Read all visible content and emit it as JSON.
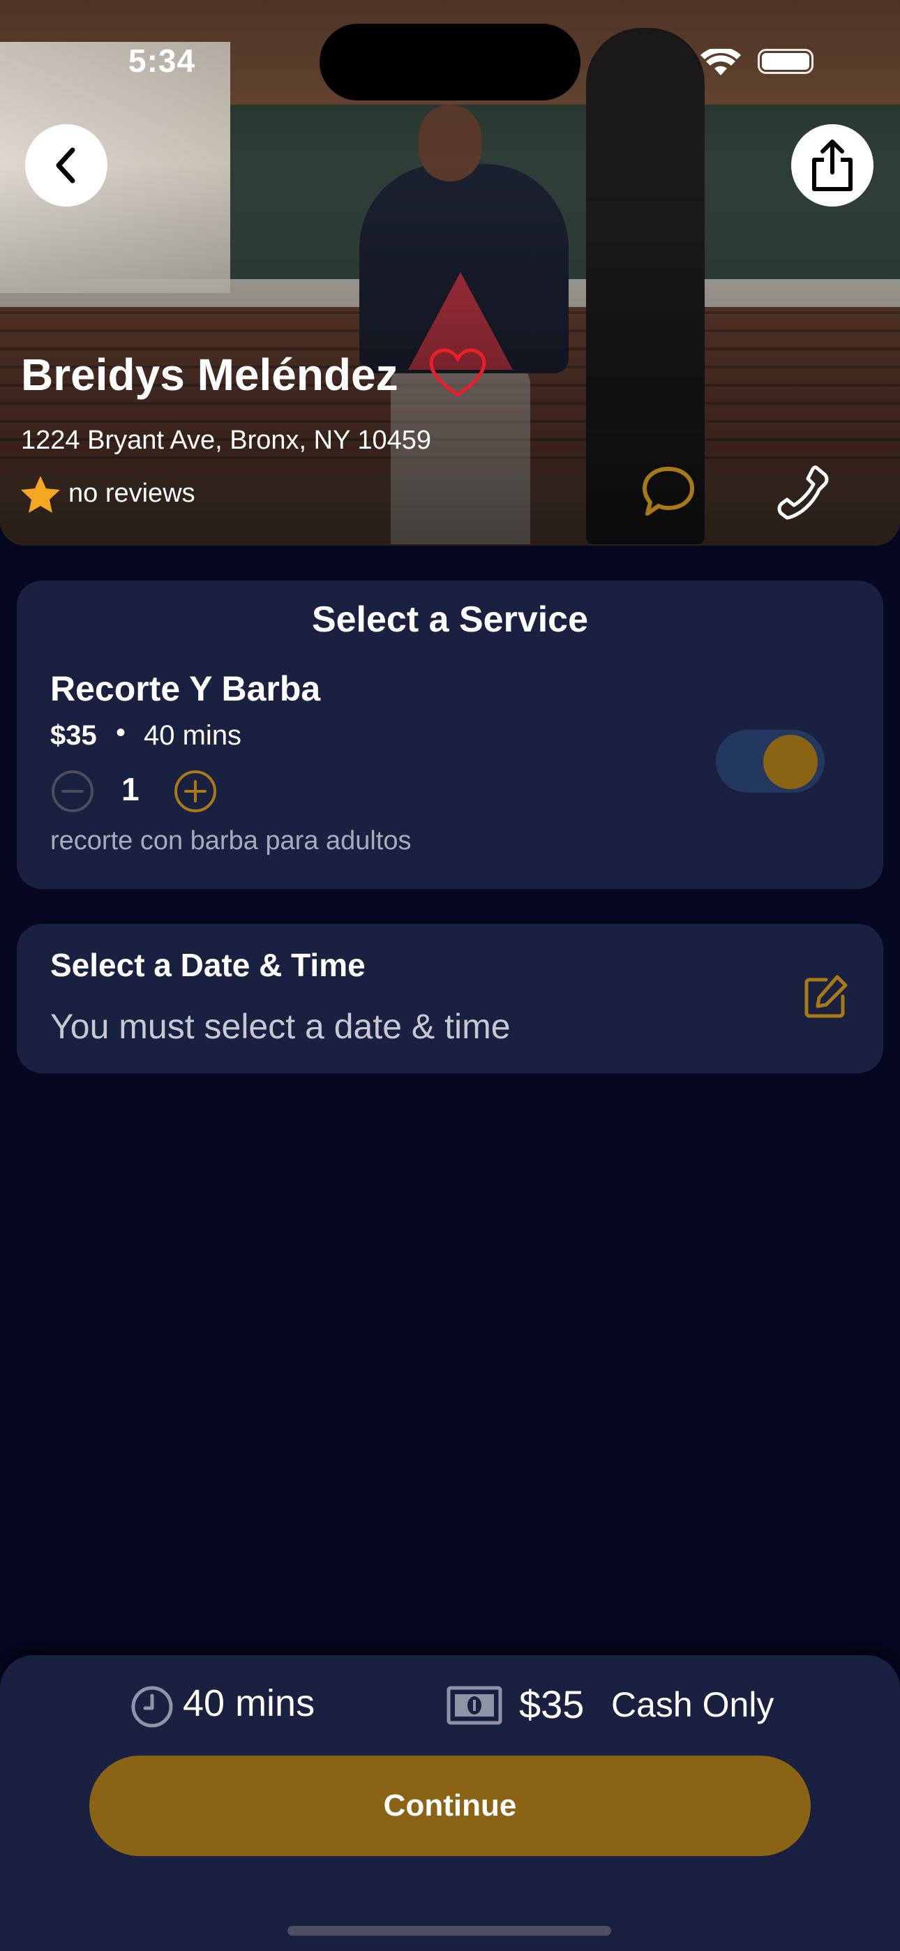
{
  "status_bar": {
    "time": "5:34"
  },
  "shop": {
    "name": "Breidys Meléndez",
    "address": "1224 Bryant Ave, Bronx, NY 10459",
    "reviews_text": "no reviews"
  },
  "service_section": {
    "title": "Select a Service",
    "service": {
      "name": "Recorte Y Barba",
      "price": "$35",
      "separator": "•",
      "duration": "40 mins",
      "quantity": "1",
      "description": "recorte con barba para adultos",
      "selected": true
    }
  },
  "datetime_section": {
    "title": "Select a Date & Time",
    "subtitle": "You must select a date & time"
  },
  "summary": {
    "duration": "40 mins",
    "price": "$35",
    "payment": "Cash Only",
    "continue_label": "Continue"
  },
  "colors": {
    "background": "#050820",
    "card": "#1a2140",
    "accent": "#8a6414",
    "heart": "#e8202c",
    "star": "#f5a623"
  }
}
